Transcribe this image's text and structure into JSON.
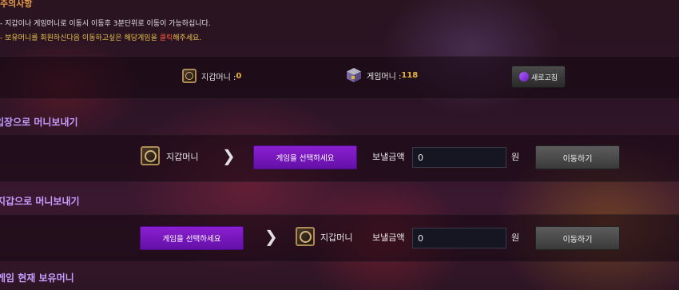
{
  "notice": {
    "title": "주의사항",
    "line1": "- 지갑이나 게임머니로 이동시 이동후 3분단위로 이동이 가능하십니다.",
    "line2_pre": "- 보유머니를 회원하신다음 이동하고싶은 해당게임을 ",
    "line2_highlight": "클릭",
    "line2_post": "해주세요."
  },
  "balances": {
    "wallet_label": "지갑머니 : ",
    "wallet_value": "0",
    "game_label": "게임머니 : ",
    "game_value": "118",
    "refresh_label": "새로고침"
  },
  "section1": {
    "title": "입장으로 머니보내기",
    "wallet_label": "지갑머니",
    "select_game": "게임을 선택하세요",
    "amount_label": "보낼금액",
    "amount_value": "0",
    "unit": "원",
    "move_button": "이동하기"
  },
  "section2": {
    "title": "지갑으로 머니보내기",
    "select_game": "게임을 선택하세요",
    "wallet_label": "지갑머니",
    "amount_label": "보낼금액",
    "amount_value": "0",
    "unit": "원",
    "move_button": "이동하기"
  },
  "section3": {
    "title": "게임 현재 보유머니"
  },
  "colors": {
    "accent_purple": "#7a17bd",
    "section_title": "#c79cff",
    "value_gold": "#e8b73a",
    "notice_orange": "#e39a4a"
  },
  "icons": [
    "wallet-safe-icon",
    "game-cube-icon",
    "refresh-icon",
    "chevron-right-icon"
  ]
}
